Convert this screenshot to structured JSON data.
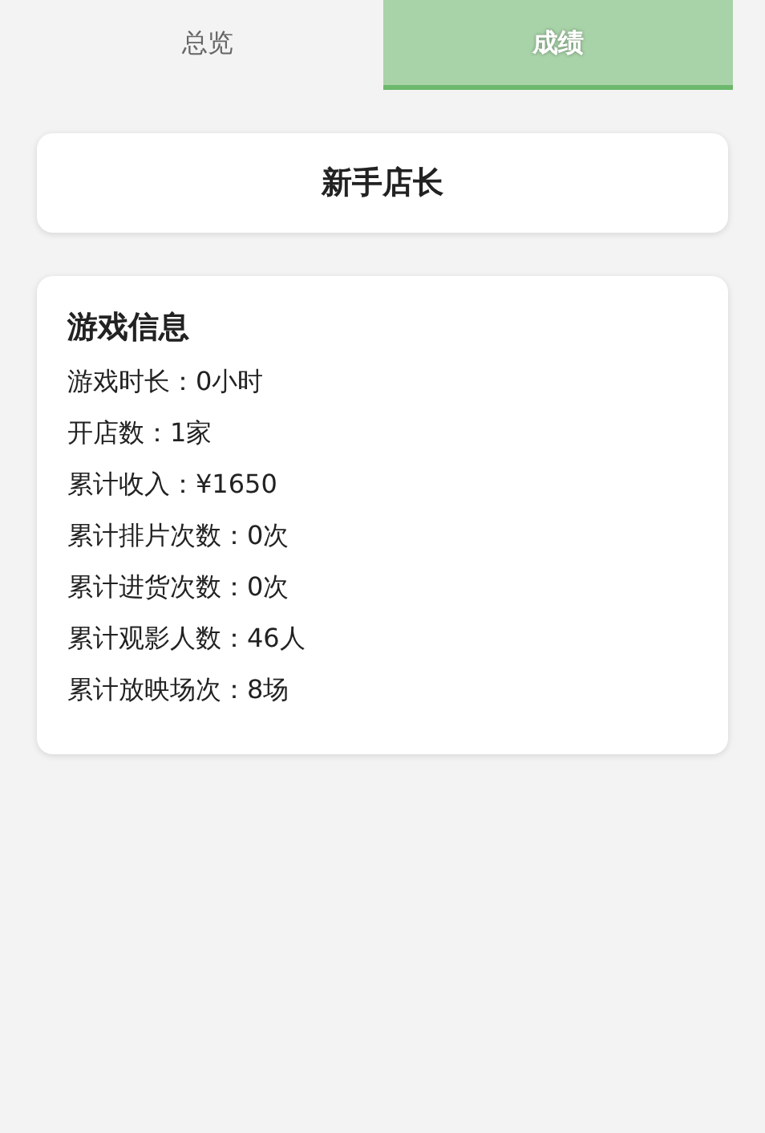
{
  "tabs": [
    {
      "label": "总览",
      "selected": false
    },
    {
      "label": "成绩",
      "selected": true
    }
  ],
  "rank": {
    "title": "新手店长"
  },
  "info": {
    "title": "游戏信息",
    "lines": [
      "游戏时长：0小时",
      "开店数：1家",
      "累计收入：¥1650",
      "累计排片次数：0次",
      "累计进货次数：0次",
      "累计观影人数：46人",
      "累计放映场次：8场"
    ]
  }
}
